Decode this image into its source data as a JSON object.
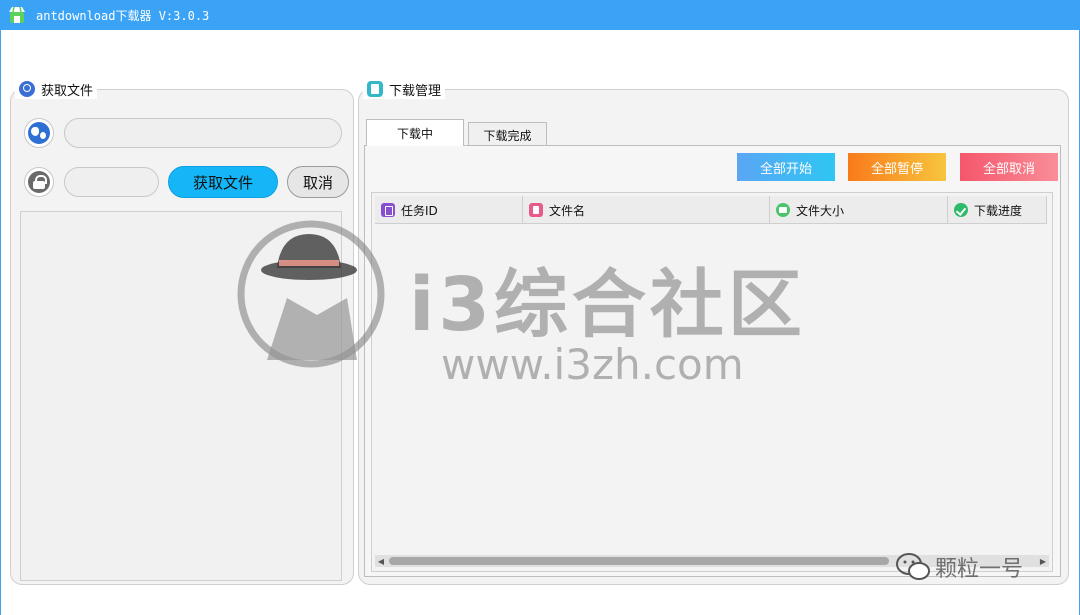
{
  "window": {
    "title": "antdownload下载器  V:3.0.3",
    "accent_color": "#3aa3f5"
  },
  "fetch_panel": {
    "title": "获取文件",
    "title_icon": "search-icon",
    "url_field": {
      "value": "",
      "placeholder": "",
      "icon": "globe-icon"
    },
    "password_field": {
      "value": "",
      "placeholder": "",
      "icon": "lock-icon"
    },
    "fetch_label": "获取文件",
    "cancel_label": "取消"
  },
  "download_panel": {
    "title": "下载管理",
    "title_icon": "clipboard-icon",
    "tabs": [
      {
        "label": "下载中",
        "active": true
      },
      {
        "label": "下载完成",
        "active": false
      }
    ],
    "actions": {
      "start_all": "全部开始",
      "pause_all": "全部暂停",
      "cancel_all": "全部取消"
    },
    "table": {
      "columns": [
        {
          "label": "任务ID",
          "icon": "edit-icon"
        },
        {
          "label": "文件名",
          "icon": "file-icon"
        },
        {
          "label": "文件大小",
          "icon": "size-icon"
        },
        {
          "label": "下载进度",
          "icon": "check-icon"
        }
      ],
      "rows": []
    }
  },
  "watermark": {
    "brand": "i3综合社区",
    "url": "www.i3zh.com"
  },
  "corner_mark": {
    "text": "颗粒一号",
    "icon": "wechat-icon"
  }
}
